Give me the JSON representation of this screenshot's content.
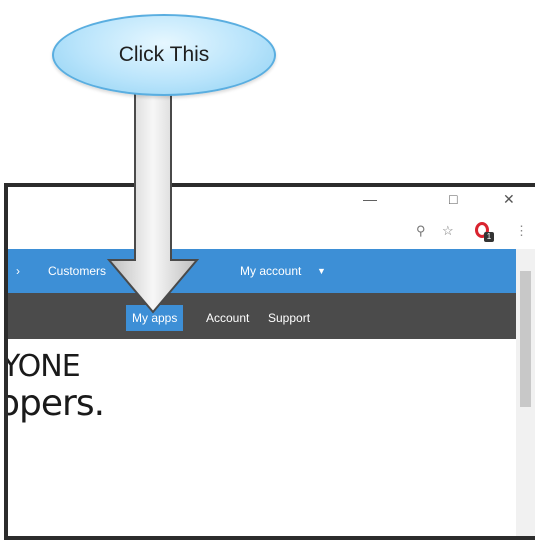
{
  "callout": {
    "label": "Click This"
  },
  "browser": {
    "window_controls": [
      "—",
      "□",
      "✕"
    ],
    "address_bar_icons": [
      "search-icon",
      "star-icon",
      "opera-extension-icon",
      "menu-icon"
    ],
    "extension_badge": "1"
  },
  "site_nav": {
    "top_items": [
      {
        "label": "Customers"
      },
      {
        "label": "My account"
      }
    ],
    "sub_tabs": [
      {
        "label": "My apps",
        "active": true
      },
      {
        "label": "Account"
      },
      {
        "label": "Support"
      }
    ]
  },
  "hero": {
    "line1": "YONE",
    "line2": "opers."
  },
  "colors": {
    "nav_blue": "#3d8fd6",
    "nav_grey": "#4b4b4b",
    "callout_fill": "#b9e4fb"
  }
}
